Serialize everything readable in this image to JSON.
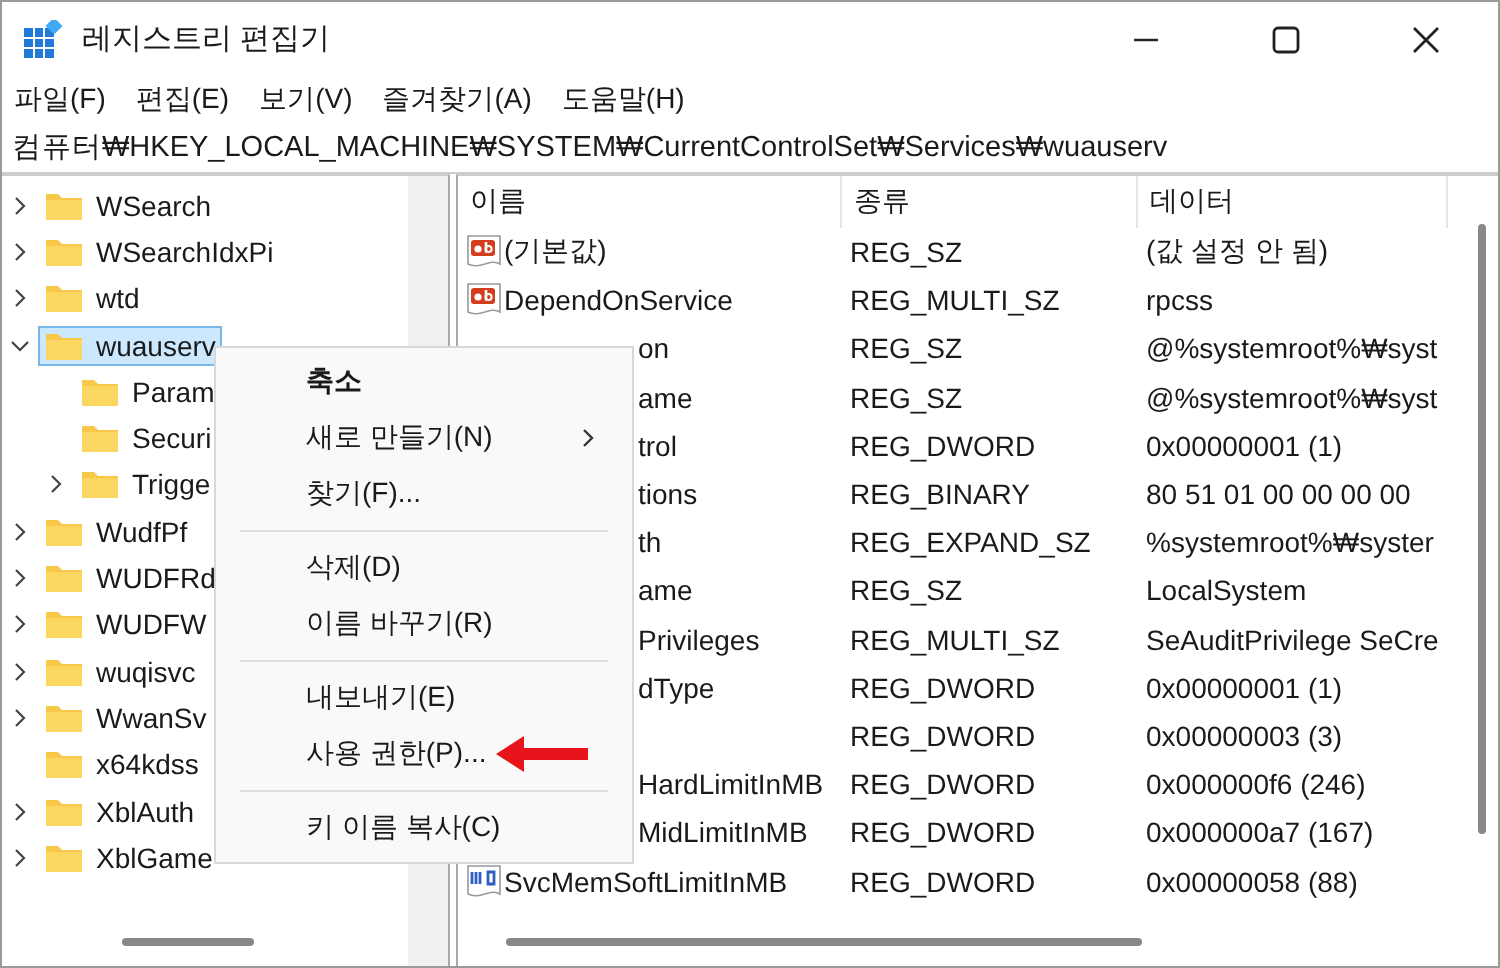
{
  "window": {
    "title": "레지스트리 편집기"
  },
  "menu_bar": [
    "파일(F)",
    "편집(E)",
    "보기(V)",
    "즐겨찾기(A)",
    "도움말(H)"
  ],
  "address": "컴퓨터₩HKEY_LOCAL_MACHINE₩SYSTEM₩CurrentControlSet₩Services₩wuauserv",
  "tree": [
    {
      "label": "WSearch",
      "kind": "branch",
      "expanded": false,
      "selected": false
    },
    {
      "label": "WSearchIdxPi",
      "kind": "branch",
      "expanded": false,
      "selected": false
    },
    {
      "label": "wtd",
      "kind": "branch",
      "expanded": false,
      "selected": false
    },
    {
      "label": "wuauserv",
      "kind": "branch",
      "expanded": true,
      "selected": true,
      "children": [
        {
          "label": "Param",
          "kind": "leaf",
          "selected": false
        },
        {
          "label": "Securi",
          "kind": "leaf",
          "selected": false
        },
        {
          "label": "Trigge",
          "kind": "branch",
          "expanded": false,
          "selected": false
        }
      ]
    },
    {
      "label": "WudfPf",
      "kind": "branch",
      "expanded": false,
      "selected": false
    },
    {
      "label": "WUDFRd",
      "kind": "branch",
      "expanded": false,
      "selected": false
    },
    {
      "label": "WUDFW",
      "kind": "branch",
      "expanded": false,
      "selected": false
    },
    {
      "label": "wuqisvc",
      "kind": "branch",
      "expanded": false,
      "selected": false
    },
    {
      "label": "WwanSv",
      "kind": "branch",
      "expanded": false,
      "selected": false
    },
    {
      "label": "x64kdss",
      "kind": "leaf",
      "selected": false
    },
    {
      "label": "XblAuth",
      "kind": "branch",
      "expanded": false,
      "selected": false
    },
    {
      "label": "XblGame",
      "kind": "branch",
      "expanded": false,
      "selected": false
    }
  ],
  "table": {
    "columns": [
      "이름",
      "종류",
      "데이터"
    ],
    "rows": [
      {
        "name": "(기본값)",
        "kind": "string",
        "type": "REG_SZ",
        "data": "(값 설정 안 됨)"
      },
      {
        "name": "DependOnService",
        "kind": "string",
        "type": "REG_MULTI_SZ",
        "data": "rpcss"
      },
      {
        "name": "on",
        "kind": "covered",
        "type": "REG_SZ",
        "data": "@%systemroot%₩syst"
      },
      {
        "name": "ame",
        "kind": "covered",
        "type": "REG_SZ",
        "data": "@%systemroot%₩syst"
      },
      {
        "name": "trol",
        "kind": "covered",
        "type": "REG_DWORD",
        "data": "0x00000001 (1)"
      },
      {
        "name": "tions",
        "kind": "covered",
        "type": "REG_BINARY",
        "data": "80 51 01 00 00 00 00"
      },
      {
        "name": "th",
        "kind": "covered",
        "type": "REG_EXPAND_SZ",
        "data": "%systemroot%₩syster"
      },
      {
        "name": "ame",
        "kind": "covered",
        "type": "REG_SZ",
        "data": "LocalSystem"
      },
      {
        "name": "Privileges",
        "kind": "covered",
        "type": "REG_MULTI_SZ",
        "data": "SeAuditPrivilege SeCre"
      },
      {
        "name": "dType",
        "kind": "covered",
        "type": "REG_DWORD",
        "data": "0x00000001 (1)"
      },
      {
        "kind": "covered",
        "type": "REG_DWORD",
        "data": "0x00000003 (3)"
      },
      {
        "name": "HardLimitInMB",
        "kind": "covered",
        "type": "REG_DWORD",
        "data": "0x000000f6 (246)"
      },
      {
        "name": "MidLimitInMB",
        "kind": "covered",
        "type": "REG_DWORD",
        "data": "0x000000a7 (167)"
      },
      {
        "name": "SvcMemSoftLimitInMB",
        "kind": "dword",
        "type": "REG_DWORD",
        "data": "0x00000058 (88)"
      }
    ]
  },
  "context_menu": [
    {
      "kind": "item",
      "label": "축소",
      "default": true,
      "submenu": false,
      "annotated": false
    },
    {
      "kind": "item",
      "label": "새로 만들기(N)",
      "default": false,
      "submenu": true,
      "annotated": false
    },
    {
      "kind": "item",
      "label": "찾기(F)...",
      "default": false,
      "submenu": false,
      "annotated": false
    },
    {
      "kind": "separator"
    },
    {
      "kind": "item",
      "label": "삭제(D)",
      "default": false,
      "submenu": false,
      "annotated": false
    },
    {
      "kind": "item",
      "label": "이름 바꾸기(R)",
      "default": false,
      "submenu": false,
      "annotated": false
    },
    {
      "kind": "separator"
    },
    {
      "kind": "item",
      "label": "내보내기(E)",
      "default": false,
      "submenu": false,
      "annotated": false
    },
    {
      "kind": "item",
      "label": "사용 권한(P)...",
      "default": false,
      "submenu": false,
      "annotated": true
    },
    {
      "kind": "separator"
    },
    {
      "kind": "item",
      "label": "키 이름 복사(C)",
      "default": false,
      "submenu": false,
      "annotated": false
    }
  ]
}
